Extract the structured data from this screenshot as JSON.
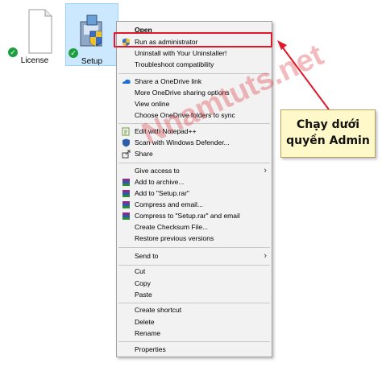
{
  "desktop": {
    "icons": [
      {
        "label": "License"
      },
      {
        "label": "Setup"
      }
    ]
  },
  "menu": {
    "open": "Open",
    "run_as_admin": "Run as administrator",
    "uninstall": "Uninstall with Your Uninstaller!",
    "troubleshoot": "Troubleshoot compatibility",
    "onedrive_share_link": "Share a OneDrive link",
    "onedrive_sharing_options": "More OneDrive sharing options",
    "view_online": "View online",
    "onedrive_sync": "Choose OneDrive folders to sync",
    "edit_notepad": "Edit with Notepad++",
    "scan_defender": "Scan with Windows Defender...",
    "share": "Share",
    "give_access": "Give access to",
    "add_archive": "Add to archive...",
    "add_setup_rar": "Add to \"Setup.rar\"",
    "compress_email": "Compress and email...",
    "compress_setup_email": "Compress to \"Setup.rar\" and email",
    "create_checksum": "Create Checksum File...",
    "restore_versions": "Restore previous versions",
    "send_to": "Send to",
    "cut": "Cut",
    "copy": "Copy",
    "paste": "Paste",
    "create_shortcut": "Create shortcut",
    "delete": "Delete",
    "rename": "Rename",
    "properties": "Properties"
  },
  "annotation": {
    "callout_line1": "Chạy dưới",
    "callout_line2": "quyền Admin",
    "highlight_color": "#e0182a",
    "watermark": "Nnamtuts.net"
  },
  "colors": {
    "menu_bg": "#f2f2f2",
    "selection_bg": "#cce8ff",
    "check_green": "#1e9f3f",
    "callout_bg": "#fff8c8"
  }
}
